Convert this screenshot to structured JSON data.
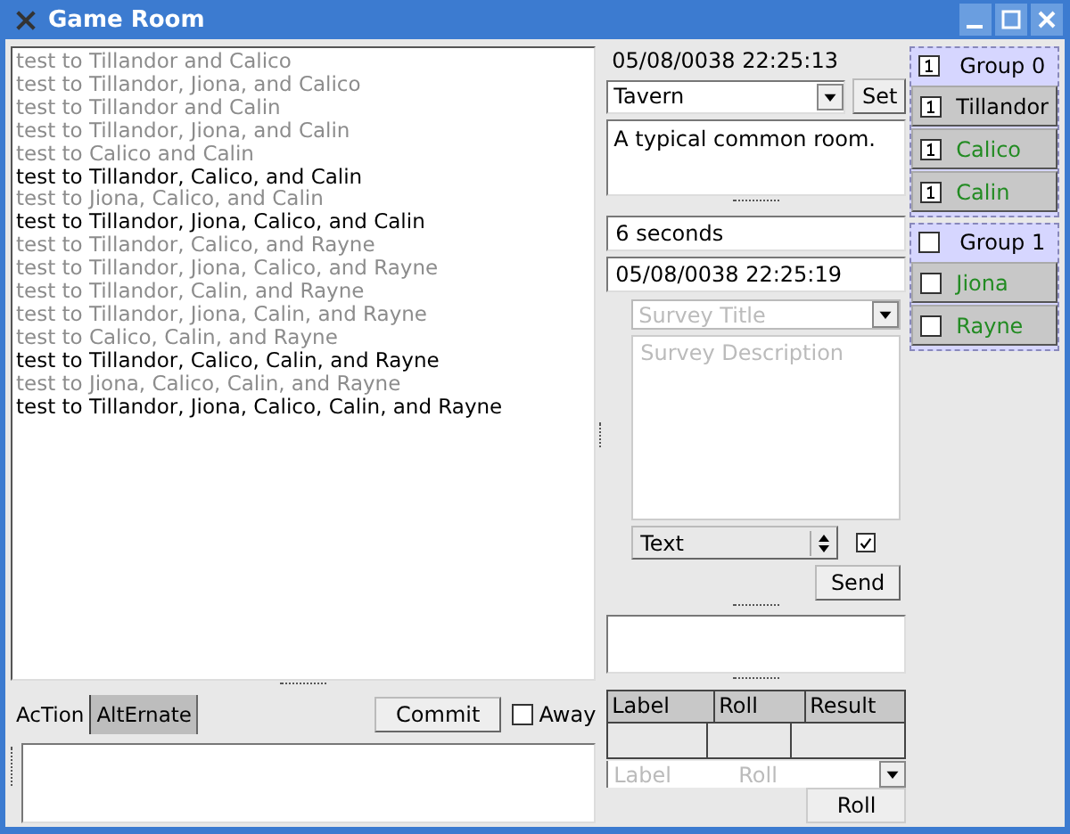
{
  "window": {
    "title": "Game Room"
  },
  "log": [
    {
      "text": "test to Tillandor and Calico",
      "dimmed": true
    },
    {
      "text": "test to Tillandor, Jiona, and Calico",
      "dimmed": true
    },
    {
      "text": "test to Tillandor and Calin",
      "dimmed": true
    },
    {
      "text": "test to Tillandor, Jiona, and Calin",
      "dimmed": true
    },
    {
      "text": "test to Calico and Calin",
      "dimmed": true
    },
    {
      "text": "test to Tillandor, Calico, and Calin",
      "dimmed": false
    },
    {
      "text": "test to Jiona, Calico, and Calin",
      "dimmed": true
    },
    {
      "text": "test to Tillandor, Jiona, Calico, and Calin",
      "dimmed": false
    },
    {
      "text": "test to Tillandor, Calico, and Rayne",
      "dimmed": true
    },
    {
      "text": "test to Tillandor, Jiona, Calico, and Rayne",
      "dimmed": true
    },
    {
      "text": "test to Tillandor, Calin, and Rayne",
      "dimmed": true
    },
    {
      "text": "test to Tillandor, Jiona, Calin, and Rayne",
      "dimmed": true
    },
    {
      "text": "test to Calico, Calin, and Rayne",
      "dimmed": true
    },
    {
      "text": "test to Tillandor, Calico, Calin, and Rayne",
      "dimmed": false
    },
    {
      "text": "test to Jiona, Calico, Calin, and Rayne",
      "dimmed": true
    },
    {
      "text": "test to Tillandor, Jiona, Calico, Calin, and Rayne",
      "dimmed": false
    }
  ],
  "tabs": [
    {
      "label": "AcTion",
      "selected": true
    },
    {
      "label": "AltErnate",
      "selected": false
    }
  ],
  "commit_button": "Commit",
  "away": {
    "label": "Away",
    "checked": false
  },
  "clock": "05/08/0038 22:25:13",
  "location": {
    "value": "Tavern",
    "button": "Set",
    "description": "A typical common room."
  },
  "interval": "6 seconds",
  "next_time": "05/08/0038 22:25:19",
  "survey": {
    "title_placeholder": "Survey Title",
    "description_placeholder": "Survey Description",
    "type": "Text",
    "checked": true,
    "send": "Send"
  },
  "roll_table": {
    "columns": [
      "Label",
      "Roll",
      "Result"
    ],
    "label_placeholder": "Label",
    "roll_placeholder": "Roll",
    "button": "Roll"
  },
  "groups": [
    {
      "name": "Group 0",
      "checked": true,
      "members": [
        {
          "name": "Tillandor",
          "checked": true,
          "color": "#000000"
        },
        {
          "name": "Calico",
          "checked": true,
          "color": "#228b22"
        },
        {
          "name": "Calin",
          "checked": true,
          "color": "#228b22"
        }
      ]
    },
    {
      "name": "Group 1",
      "checked": false,
      "members": [
        {
          "name": "Jiona",
          "checked": false,
          "color": "#228b22"
        },
        {
          "name": "Rayne",
          "checked": false,
          "color": "#228b22"
        }
      ]
    }
  ]
}
